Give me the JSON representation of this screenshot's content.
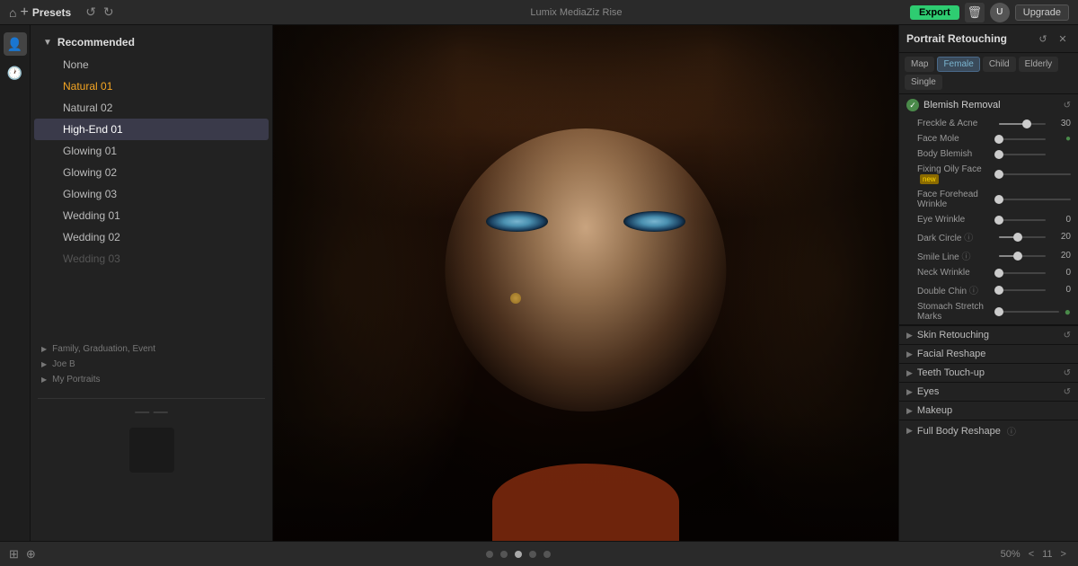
{
  "topbar": {
    "title": "Lumix MediaZiz Rise",
    "export_label": "Export",
    "upgrade_label": "Upgrade",
    "avatar_label": "U"
  },
  "presets": {
    "header_label": "Presets",
    "category": "Recommended",
    "items": [
      {
        "label": "None",
        "state": "normal"
      },
      {
        "label": "Natural 01",
        "state": "highlighted"
      },
      {
        "label": "Natural 02",
        "state": "normal"
      },
      {
        "label": "High-End 01",
        "state": "selected"
      },
      {
        "label": "Glowing 01",
        "state": "normal"
      },
      {
        "label": "Glowing 02",
        "state": "normal"
      },
      {
        "label": "Glowing 03",
        "state": "normal"
      },
      {
        "label": "Wedding 01",
        "state": "normal"
      },
      {
        "label": "Wedding 02",
        "state": "normal"
      },
      {
        "label": "Wedding 03",
        "state": "partial"
      }
    ]
  },
  "sidebar_nav": [
    {
      "label": "Family, Graduation, Event"
    },
    {
      "label": "Joe B"
    },
    {
      "label": "My Portraits"
    }
  ],
  "bottom_bar": {
    "zoom": "50%",
    "page_prev": "<",
    "page_next": ">",
    "page_num": "11"
  },
  "right_panel": {
    "title": "Portrait Retouching",
    "tabs": [
      "Map",
      "Female",
      "Child",
      "Elderly",
      "Single"
    ],
    "active_tab": "Female",
    "sections": [
      {
        "id": "blemish",
        "title": "Blemish Removal",
        "toggle": "on",
        "subsections": [
          {
            "label": "Freckle & Acne",
            "value": 30,
            "fill_pct": 60
          },
          {
            "label": "Face Mole",
            "value": 0,
            "fill_pct": 0
          },
          {
            "label": "Body Blemish",
            "value": 0,
            "fill_pct": 0
          },
          {
            "label": "Fixing Oily Face",
            "value": 0,
            "fill_pct": 0,
            "badge": "new"
          },
          {
            "label": "Face Forehead Wrinkle",
            "value": 0,
            "fill_pct": 0
          },
          {
            "label": "Eye Wrinkle",
            "value": 0,
            "fill_pct": 0
          },
          {
            "label": "Dark Circle",
            "value": 20,
            "fill_pct": 40
          },
          {
            "label": "Smile Line",
            "value": 20,
            "fill_pct": 40
          },
          {
            "label": "Neck Wrinkle",
            "value": 0,
            "fill_pct": 0
          },
          {
            "label": "Double Chin",
            "value": 0,
            "fill_pct": 0
          },
          {
            "label": "Stomach Stretch Marks",
            "value": 0,
            "fill_pct": 0
          }
        ]
      },
      {
        "id": "skin",
        "title": "Skin Retouching",
        "toggle": "blue"
      },
      {
        "id": "facial",
        "title": "Facial Reshape",
        "toggle": "off"
      },
      {
        "id": "teeth",
        "title": "Teeth Touch-up",
        "toggle": "off"
      },
      {
        "id": "eyes",
        "title": "Eyes",
        "toggle": "off"
      },
      {
        "id": "makeup",
        "title": "Makeup",
        "toggle": "off"
      },
      {
        "id": "fullbody",
        "title": "Full Body Reshape",
        "toggle": "off"
      }
    ]
  }
}
